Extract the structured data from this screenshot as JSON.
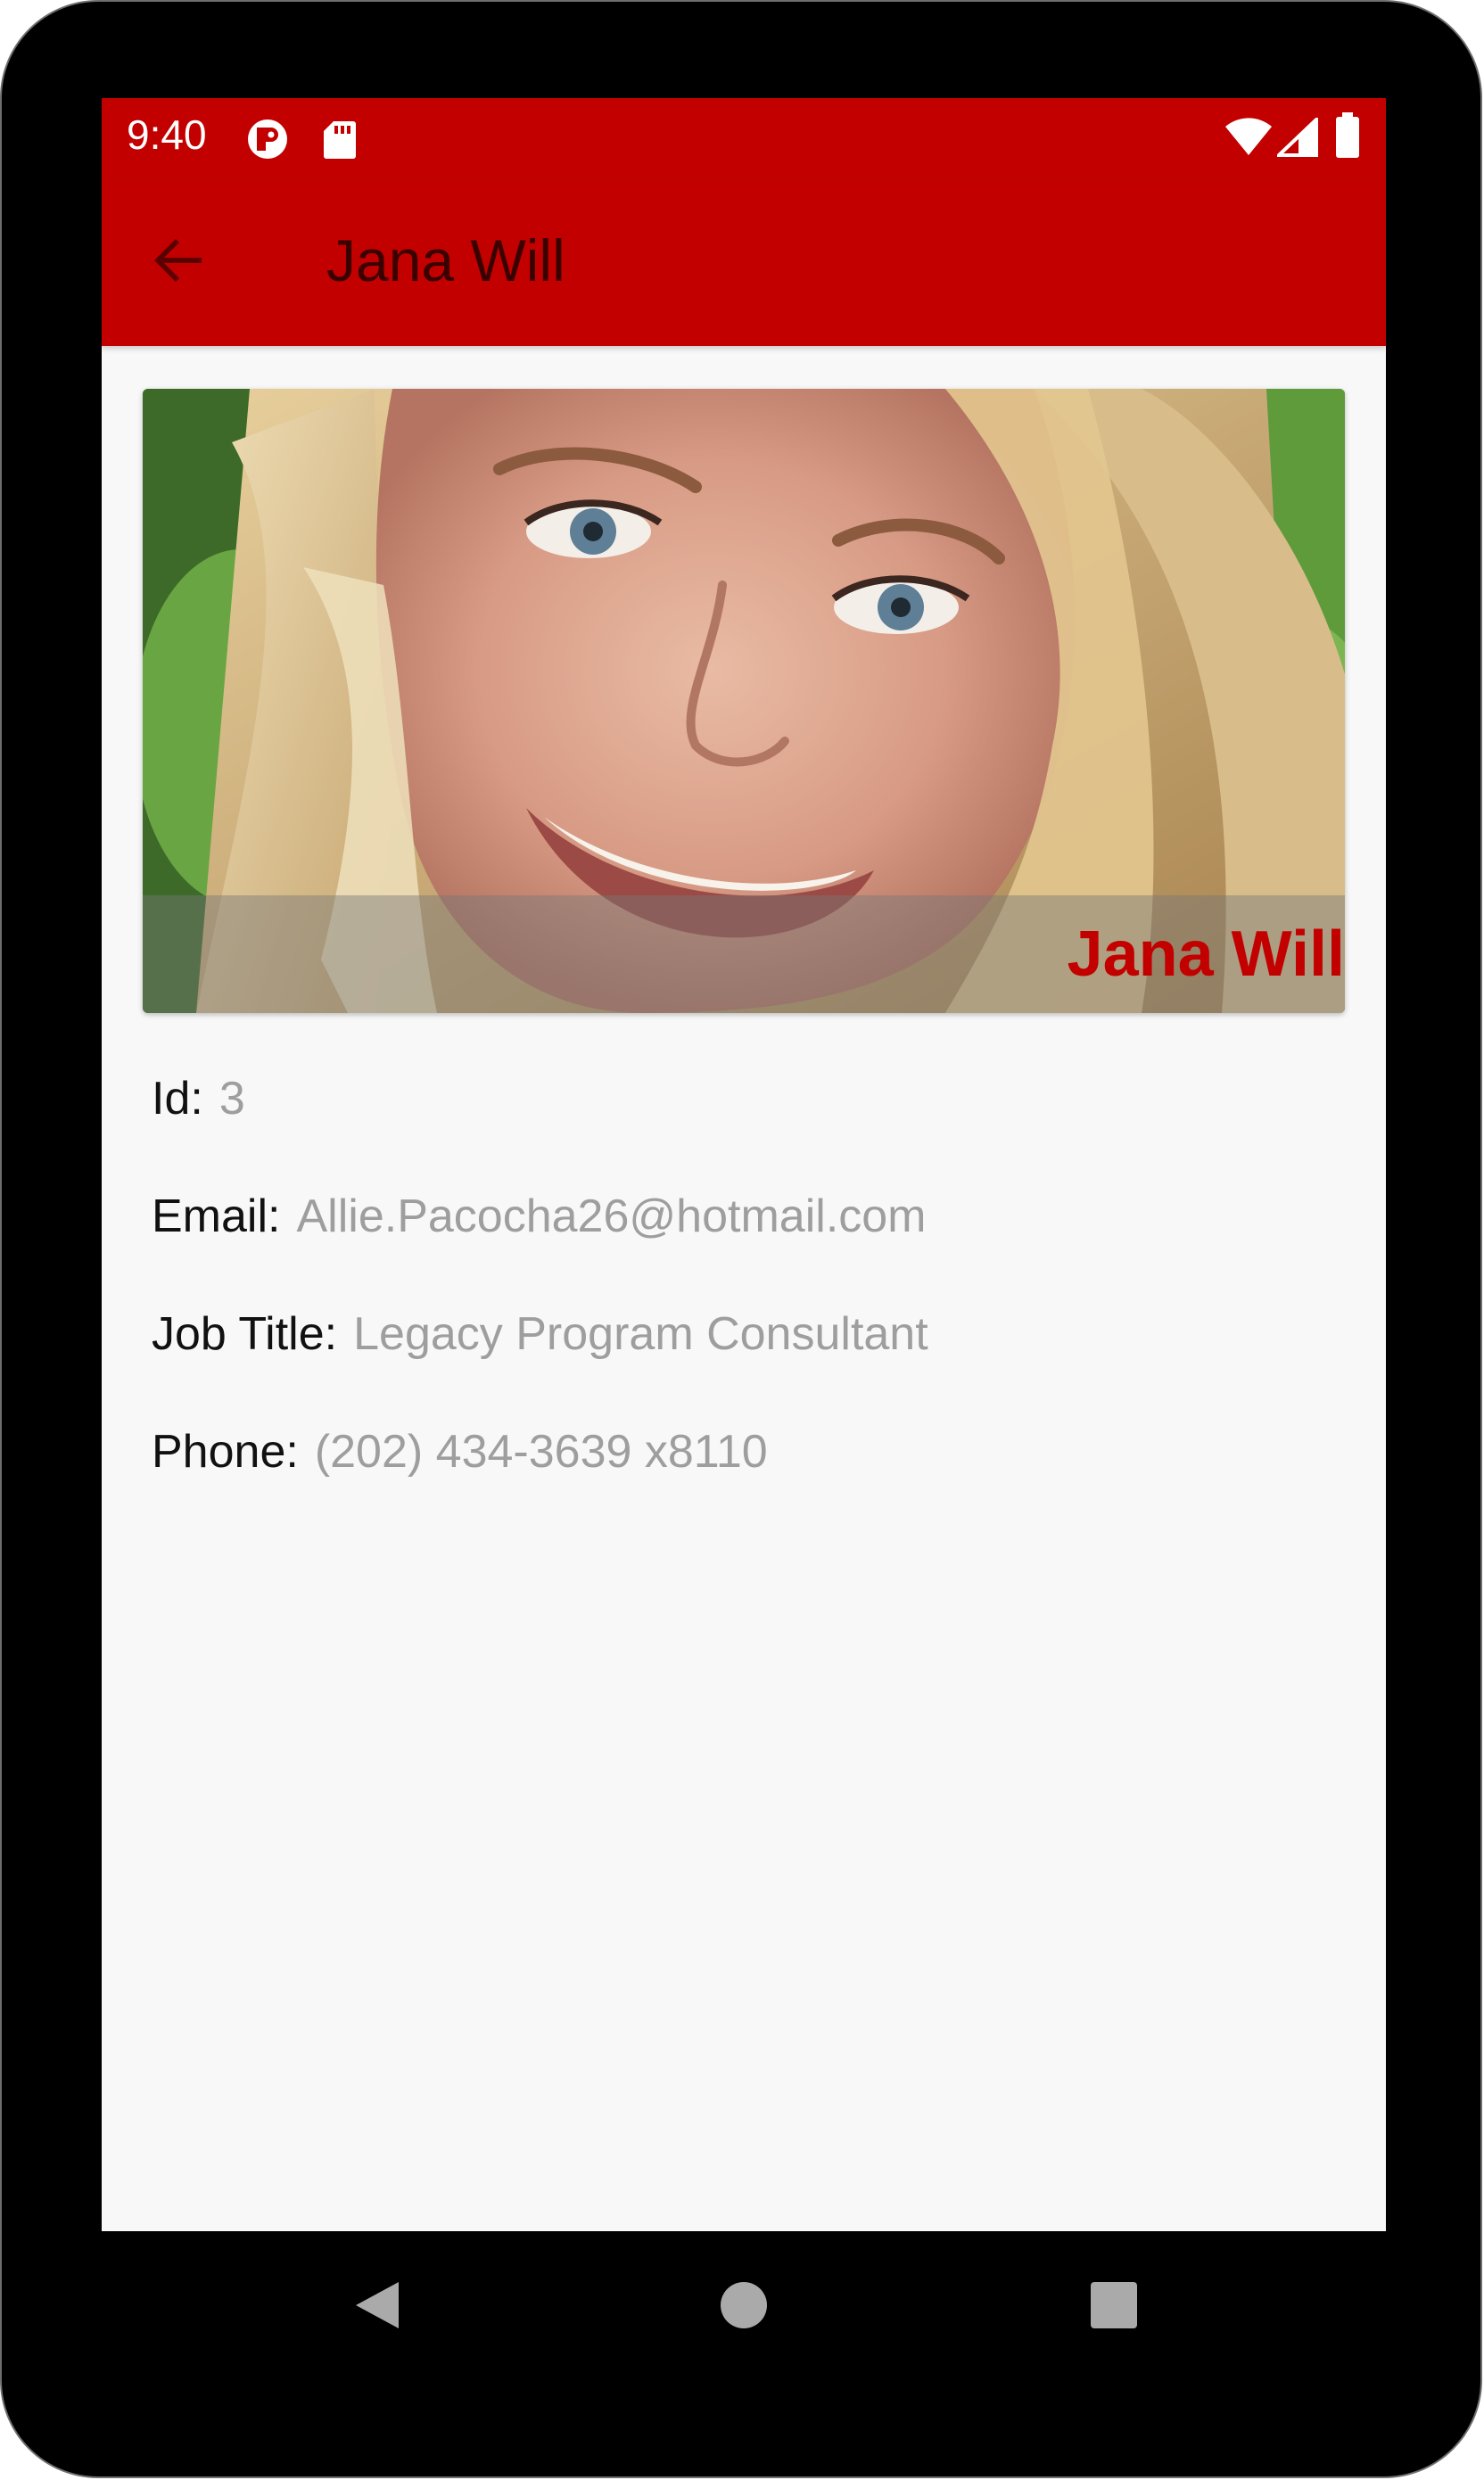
{
  "status_bar": {
    "time": "9:40",
    "icons": [
      "notification-app-icon",
      "sd-card-icon",
      "wifi-icon",
      "signal-icon",
      "battery-icon"
    ]
  },
  "app_bar": {
    "title": "Jana Will",
    "back_icon": "arrow-back-icon"
  },
  "photo": {
    "caption": "Jana Will",
    "alt": "portrait photo"
  },
  "details": {
    "id": {
      "label": "Id:",
      "value": "3"
    },
    "email": {
      "label": "Email:",
      "value": "Allie.Pacocha26@hotmail.com"
    },
    "job_title": {
      "label": "Job Title:",
      "value": "Legacy Program Consultant"
    },
    "phone": {
      "label": "Phone:",
      "value": "(202) 434-3639 x8110"
    }
  },
  "nav_bar": {
    "back": "triangle-back-icon",
    "home": "circle-home-icon",
    "recents": "square-recents-icon"
  },
  "colors": {
    "primary": "#c30000",
    "title_text": "#3a0000",
    "value_text": "#9e9e9e",
    "background": "#f8f8f8"
  }
}
